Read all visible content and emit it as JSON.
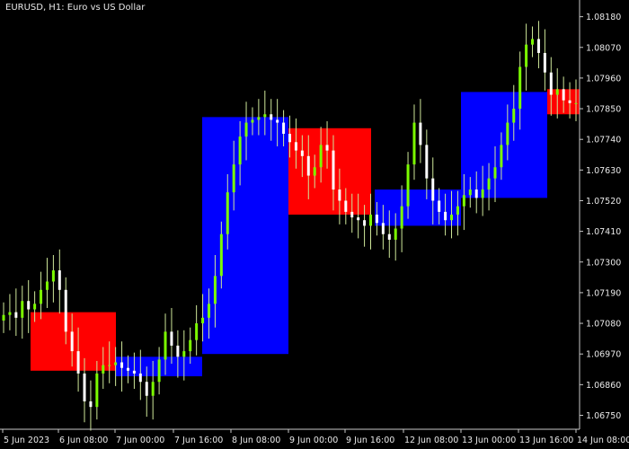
{
  "window": {
    "title": "EURUSD, H1:  Euro vs US Dollar",
    "symbol": "EURUSD",
    "timeframe": "H1",
    "description": "Euro vs US Dollar"
  },
  "colors": {
    "background": "#000000",
    "axis": "#c8c8c8",
    "text": "#e8e8e8",
    "candle_up": "#7CFC00",
    "candle_down": "#ffffff",
    "candle_line": "#cfe89a",
    "box_bull": "#0000ff",
    "box_bear": "#ff0000"
  },
  "chart_data": {
    "type": "line",
    "title": "EURUSD, H1:  Euro vs US Dollar",
    "price_ticks": [
      "1.08180",
      "1.08070",
      "1.07960",
      "1.07850",
      "1.07740",
      "1.07630",
      "1.07520",
      "1.07410",
      "1.07300",
      "1.07190",
      "1.07080",
      "1.06970",
      "1.06860",
      "1.06750"
    ],
    "time_ticks": [
      "5 Jun 2023",
      "6 Jun 08:00",
      "7 Jun 00:00",
      "7 Jun 16:00",
      "8 Jun 08:00",
      "9 Jun 00:00",
      "9 Jun 16:00",
      "12 Jun 08:00",
      "13 Jun 00:00",
      "13 Jun 16:00",
      "14 Jun 08:00"
    ],
    "ylim": [
      1.067,
      1.0824
    ],
    "grid": false,
    "boxes": [
      {
        "color": "red",
        "top": 1.0712,
        "bottom": 1.0691
      },
      {
        "color": "blue",
        "top": 1.0696,
        "bottom": 1.0689
      },
      {
        "color": "blue",
        "top": 1.0782,
        "bottom": 1.0697
      },
      {
        "color": "red",
        "top": 1.0778,
        "bottom": 1.0747
      },
      {
        "color": "blue",
        "top": 1.0756,
        "bottom": 1.0743
      },
      {
        "color": "blue",
        "top": 1.0791,
        "bottom": 1.0753
      },
      {
        "color": "red",
        "top": 1.0792,
        "bottom": 1.0783
      }
    ],
    "price_path": [
      1.0711,
      1.0712,
      1.071,
      1.0716,
      1.0713,
      1.0715,
      1.072,
      1.0723,
      1.0727,
      1.072,
      1.0705,
      1.0698,
      1.069,
      1.068,
      1.0678,
      1.069,
      1.0693,
      1.0693,
      1.0694,
      1.0692,
      1.0691,
      1.069,
      1.0687,
      1.0682,
      1.0687,
      1.0695,
      1.0705,
      1.07,
      1.0696,
      1.0698,
      1.0702,
      1.0708,
      1.071,
      1.0715,
      1.0725,
      1.074,
      1.0755,
      1.0765,
      1.0775,
      1.078,
      1.0781,
      1.0782,
      1.0783,
      1.0781,
      1.078,
      1.0776,
      1.0773,
      1.077,
      1.0768,
      1.0761,
      1.0764,
      1.0772,
      1.077,
      1.0756,
      1.0752,
      1.0748,
      1.0746,
      1.0745,
      1.0743,
      1.0747,
      1.0744,
      1.074,
      1.0738,
      1.0742,
      1.075,
      1.0765,
      1.078,
      1.0772,
      1.076,
      1.0752,
      1.0748,
      1.0745,
      1.0747,
      1.075,
      1.0754,
      1.0756,
      1.0753,
      1.0756,
      1.076,
      1.0764,
      1.0772,
      1.078,
      1.0785,
      1.08,
      1.0808,
      1.081,
      1.0805,
      1.0798,
      1.079,
      1.0792,
      1.0788,
      1.0787,
      1.0787
    ]
  }
}
